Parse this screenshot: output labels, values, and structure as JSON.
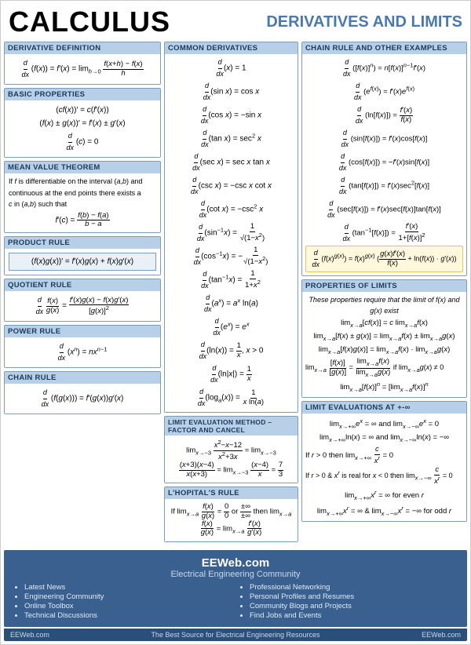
{
  "header": {
    "left_title": "CALCULUS",
    "right_title": "DERIVATIVES AND LIMITS"
  },
  "sections": {
    "derivative_definition": {
      "title": "DERIVATIVE DEFINITION"
    },
    "basic_properties": {
      "title": "BASIC PROPERTIES"
    },
    "mean_value": {
      "title": "MEAN VALUE THEOREM"
    },
    "product_rule": {
      "title": "PRODUCT RULE"
    },
    "quotient_rule": {
      "title": "QUOTIENT RULE"
    },
    "power_rule": {
      "title": "POWER RULE"
    },
    "chain_rule_left": {
      "title": "CHAIN RULE"
    },
    "common_derivatives": {
      "title": "COMMON DERIVATIVES"
    },
    "limit_eval": {
      "title": "LIMIT EVALUATION METHOD – FACTOR AND CANCEL"
    },
    "lhopital": {
      "title": "L'HOPITAL'S RULE"
    },
    "chain_rule_right": {
      "title": "CHAIN RULE AND OTHER EXAMPLES"
    },
    "properties_limits": {
      "title": "PROPERTIES OF LIMITS"
    },
    "limit_evaluations": {
      "title": "LIMIT EVALUATIONS AT +-∞"
    }
  },
  "footer": {
    "site": "EEWeb.com",
    "community": "Electrical Engineering Community",
    "col1": [
      "Latest News",
      "Engineering Community",
      "Online Toolbox",
      "Technical Discussions"
    ],
    "col2": [
      "Professional Networking",
      "Personal Profiles and Resumes",
      "Community Blogs and Projects",
      "Find Jobs and Events"
    ],
    "bottom_left": "EEWeb.com",
    "bottom_center": "The Best Source for Electrical Engineering Resources",
    "bottom_right": "EEWeb.com"
  }
}
